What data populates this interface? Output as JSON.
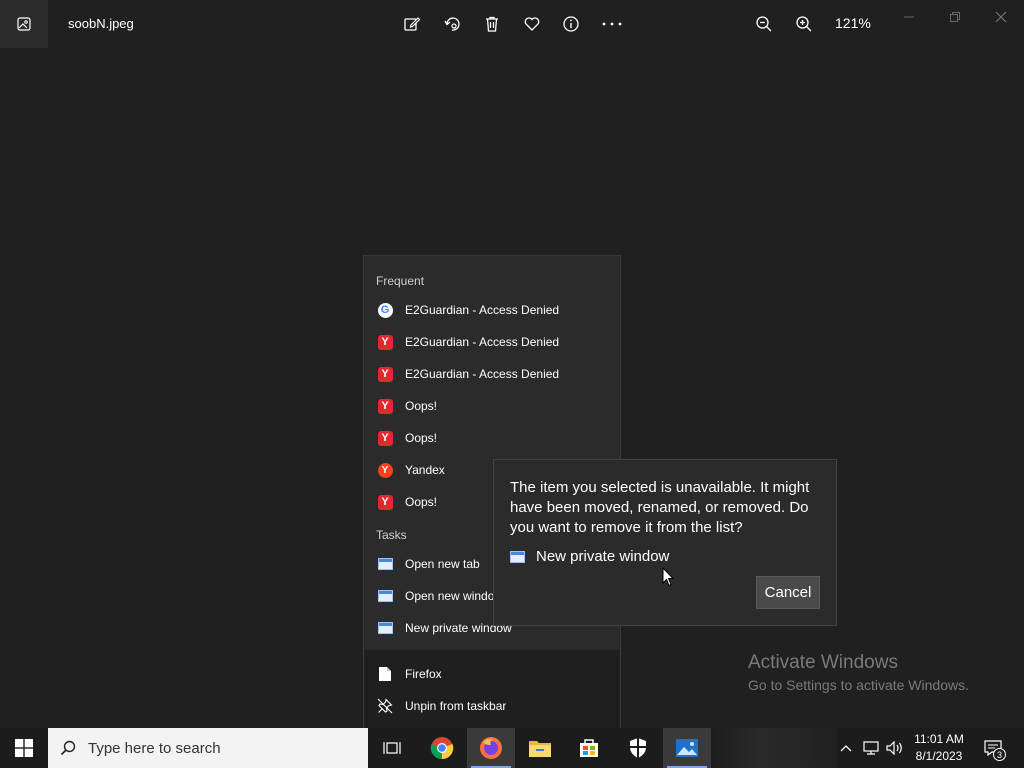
{
  "titlebar": {
    "filename": "soobN.jpeg",
    "zoom": "121%",
    "icons": [
      "edit-icon",
      "rotate-icon",
      "delete-icon",
      "favorite-icon",
      "info-icon",
      "more-icon",
      "zoom-out-icon",
      "zoom-in-icon"
    ]
  },
  "jumplist": {
    "frequent_header": "Frequent",
    "frequent": [
      {
        "label": "E2Guardian - Access Denied",
        "icon": "google-icon"
      },
      {
        "label": "E2Guardian - Access Denied",
        "icon": "yandex-browser-icon"
      },
      {
        "label": "E2Guardian - Access Denied",
        "icon": "yandex-browser-icon"
      },
      {
        "label": "Oops!",
        "icon": "yandex-browser-icon"
      },
      {
        "label": "Oops!",
        "icon": "yandex-browser-icon"
      },
      {
        "label": "Yandex",
        "icon": "yandex-icon"
      },
      {
        "label": "Oops!",
        "icon": "yandex-browser-icon"
      }
    ],
    "tasks_header": "Tasks",
    "tasks": [
      {
        "label": "Open new tab"
      },
      {
        "label": "Open new window"
      },
      {
        "label": "New private window"
      }
    ],
    "app_name": "Firefox",
    "unpin": "Unpin from taskbar"
  },
  "dialog": {
    "message": "The item you selected is unavailable. It might have been moved, renamed, or removed. Do you want to remove it from the list?",
    "item": "New private window",
    "cancel": "Cancel"
  },
  "watermark": {
    "title": "Activate Windows",
    "subtitle": "Go to Settings to activate Windows."
  },
  "taskbar": {
    "search_placeholder": "Type here to search",
    "time": "11:01 AM",
    "date": "8/1/2023",
    "notification_count": "3"
  }
}
